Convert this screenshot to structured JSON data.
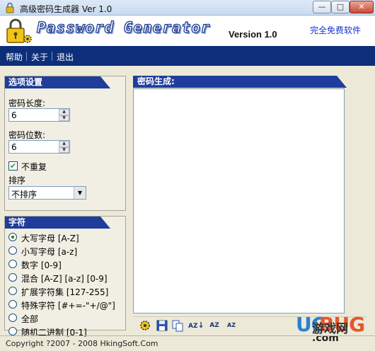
{
  "window": {
    "title": "高级密码生成器 Ver 1.0",
    "min": "—",
    "max": "□",
    "close": "✕"
  },
  "banner": {
    "brand": "Password Generator",
    "version": "Version 1.0",
    "freeware": "完全免费软件"
  },
  "menu": {
    "items": [
      "帮助",
      "关于",
      "退出"
    ]
  },
  "options": {
    "header": "选项设置",
    "length_label": "密码长度:",
    "length_value": "6",
    "count_label": "密码位数:",
    "count_value": "6",
    "no_repeat_label": "不重复",
    "no_repeat_checked": true,
    "sort_label": "排序",
    "sort_value": "不排序"
  },
  "charset": {
    "header": "字符",
    "items": [
      {
        "label": "大写字母 [A-Z]",
        "checked": true
      },
      {
        "label": "小写字母 [a-z]",
        "checked": false
      },
      {
        "label": "数字 [0-9]",
        "checked": false
      },
      {
        "label": "混合 [A-Z] [a-z] [0-9]",
        "checked": false
      },
      {
        "label": "扩展字符集 [127-255]",
        "checked": false
      },
      {
        "label": "特殊字符 [#+=-\"+/@\"]",
        "checked": false
      },
      {
        "label": "全部",
        "checked": false
      },
      {
        "label": "随机二进制 [0-1]",
        "checked": false
      }
    ]
  },
  "output": {
    "header": "密码生成:",
    "value": ""
  },
  "toolbar": {
    "icons": [
      "gear-icon",
      "save-icon",
      "copy-icon",
      "sort-az-icon",
      "sort-za-icon",
      "sort-small-icon"
    ],
    "sort_az": "AZ",
    "sort_za": "AZ",
    "sort_small": "AZ"
  },
  "watermark": {
    "uc": "UC",
    "bug": "BUG",
    "cn": "游戏网",
    "dotcom": ".com"
  },
  "status": {
    "copyright": "Copyright ?2007 - 2008 HkingSoft.Com"
  },
  "colors": {
    "menubar": "#0d2f7a",
    "panel_header": "#1f3d9a",
    "freeware_link": "#1732c9"
  }
}
